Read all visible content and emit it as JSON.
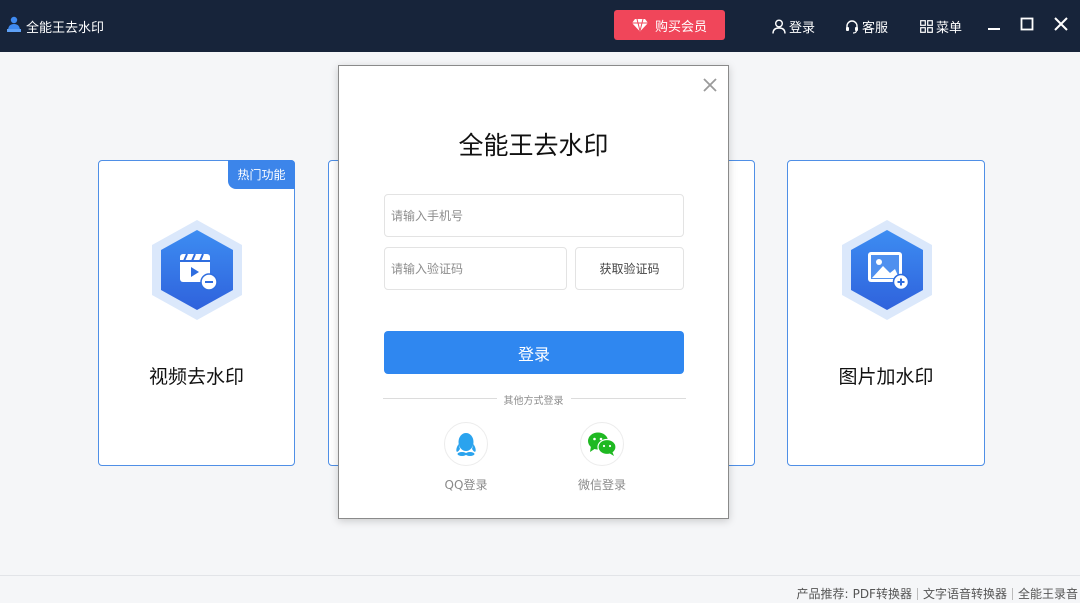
{
  "app": {
    "title": "全能王去水印"
  },
  "titlebar": {
    "buy_label": "购买会员",
    "login_label": "登录",
    "service_label": "客服",
    "menu_label": "菜单"
  },
  "cards": [
    {
      "label": "视频去水印",
      "badge": "热门功能"
    },
    {
      "label": "图片加水印"
    }
  ],
  "login_modal": {
    "title": "全能王去水印",
    "phone_placeholder": "请输入手机号",
    "code_placeholder": "请输入验证码",
    "get_code_label": "获取验证码",
    "submit_label": "登录",
    "other_methods": "其他方式登录",
    "qq_label": "QQ登录",
    "wechat_label": "微信登录"
  },
  "footer": {
    "prefix": "产品推荐:",
    "links": [
      "PDF转换器",
      "文字语音转换器",
      "全能王录音"
    ]
  },
  "colors": {
    "titlebar": "#17243a",
    "buy_button": "#f0465a",
    "primary": "#2f87f0",
    "card_border": "#4f8fe6",
    "wechat": "#1fb922",
    "qq": "#2aa3ee"
  },
  "icons": {
    "app": "app-logo-icon",
    "buy": "diamond-icon",
    "login": "user-icon",
    "service": "headset-icon",
    "menu": "grid-icon",
    "minimize": "minimize-icon",
    "maximize": "maximize-icon",
    "close": "close-icon",
    "video": "video-icon",
    "image": "image-icon",
    "qq": "qq-icon",
    "wechat": "wechat-icon"
  }
}
